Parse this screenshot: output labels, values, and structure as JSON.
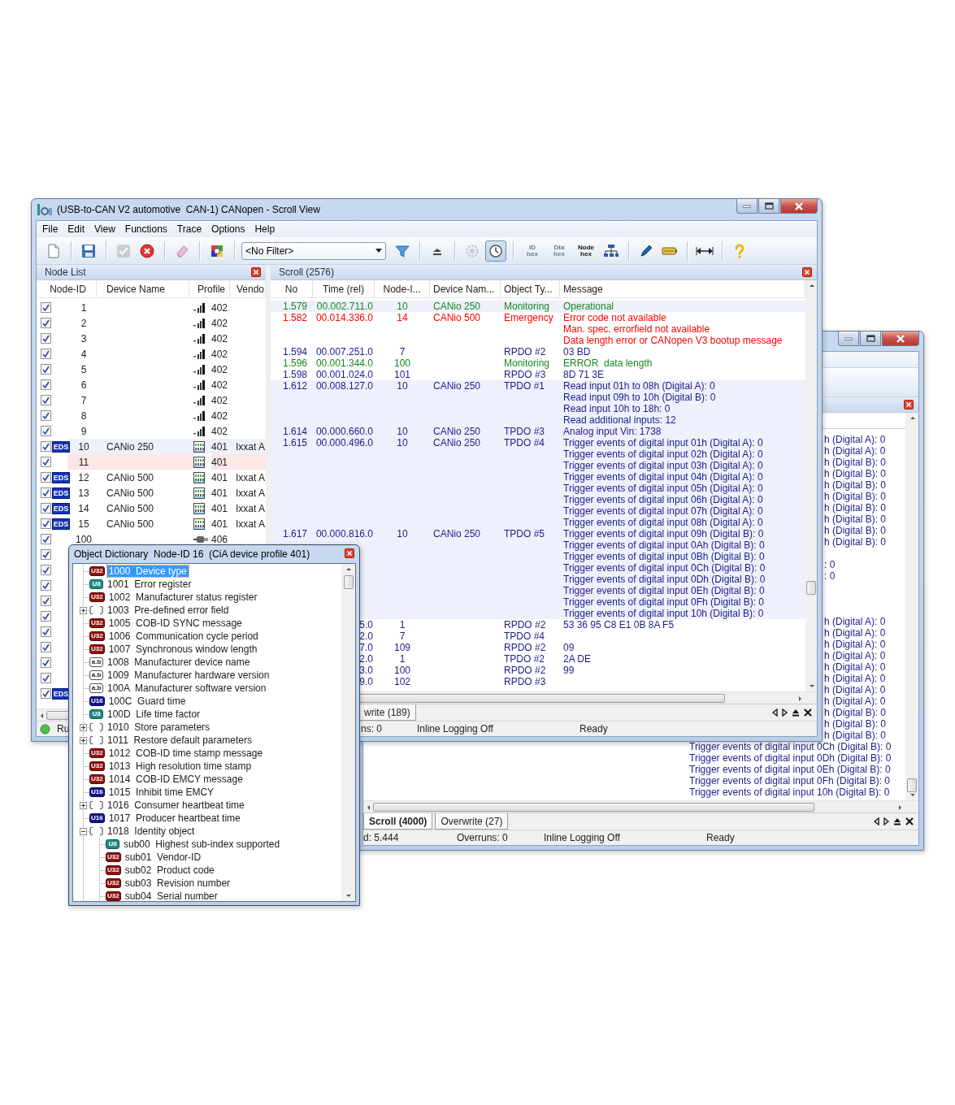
{
  "back_window": {
    "messages": [
      {
        "kind": "cut",
        "text": "h (Digital A): 0"
      },
      {
        "kind": "cut",
        "text": "h (Digital A): 0"
      },
      {
        "kind": "cut",
        "text": "h (Digital B): 0"
      },
      {
        "kind": "cut",
        "text": "h (Digital B): 0"
      },
      {
        "kind": "cut",
        "text": "h (Digital B): 0"
      },
      {
        "kind": "cut",
        "text": "h (Digital B): 0"
      },
      {
        "kind": "cut",
        "text": "h (Digital B): 0"
      },
      {
        "kind": "cut",
        "text": "h (Digital B): 0"
      },
      {
        "kind": "cut",
        "text": "h (Digital B): 0"
      },
      {
        "kind": "cut",
        "text": "h (Digital B): 0"
      },
      {
        "kind": "blank"
      },
      {
        "kind": "cut",
        "text": ": 0"
      },
      {
        "kind": "cut",
        "text": ": 0"
      },
      {
        "kind": "blank"
      },
      {
        "kind": "blank"
      },
      {
        "kind": "blank"
      },
      {
        "kind": "cut",
        "text": "h (Digital A): 0"
      },
      {
        "kind": "cut",
        "text": "h (Digital A): 0"
      },
      {
        "kind": "cut",
        "text": "h (Digital A): 0"
      },
      {
        "kind": "cut",
        "text": "h (Digital A): 0"
      },
      {
        "kind": "cut",
        "text": "h (Digital A): 0"
      },
      {
        "kind": "cut",
        "text": "h (Digital A): 0"
      },
      {
        "kind": "cut",
        "text": "h (Digital A): 0"
      },
      {
        "kind": "cut",
        "text": "h (Digital A): 0"
      },
      {
        "kind": "cut",
        "text": "h (Digital B): 0"
      },
      {
        "kind": "cut",
        "text": "h (Digital B): 0"
      },
      {
        "kind": "cut",
        "text": "h (Digital B): 0"
      },
      {
        "kind": "full",
        "text": "Trigger events of digital input 0Ch (Digital B): 0"
      },
      {
        "kind": "full",
        "text": "Trigger events of digital input 0Dh (Digital B): 0"
      },
      {
        "kind": "full",
        "text": "Trigger events of digital input 0Eh (Digital B): 0"
      },
      {
        "kind": "full",
        "text": "Trigger events of digital input 0Fh (Digital B): 0"
      },
      {
        "kind": "full",
        "text": "Trigger events of digital input 10h (Digital B): 0"
      }
    ],
    "tabs": [
      {
        "label": "Scroll (4000)",
        "selected": true
      },
      {
        "label": "Overwrite (27)",
        "selected": false
      }
    ],
    "status": [
      "d: 5.444",
      "Overruns: 0",
      "Inline Logging Off",
      "Ready"
    ]
  },
  "main_window": {
    "title": "(USB-to-CAN V2 automotive  CAN-1) CANopen - Scroll View",
    "menu": [
      {
        "label": "File"
      },
      {
        "label": "Edit"
      },
      {
        "label": "View"
      },
      {
        "label": "Functions"
      },
      {
        "label": "Trace"
      },
      {
        "label": "Options"
      },
      {
        "label": "Help"
      }
    ],
    "toolbar": [
      {
        "kind": "new",
        "disabled": false,
        "pressed": false
      },
      {
        "kind": "separator"
      },
      {
        "kind": "save",
        "disabled": false,
        "pressed": false
      },
      {
        "kind": "separator"
      },
      {
        "kind": "check",
        "disabled": true,
        "pressed": false
      },
      {
        "kind": "cancel",
        "disabled": false,
        "pressed": false
      },
      {
        "kind": "separator"
      },
      {
        "kind": "eraser",
        "disabled": false,
        "pressed": false
      },
      {
        "kind": "separator"
      },
      {
        "kind": "colors",
        "disabled": false,
        "pressed": false
      },
      {
        "kind": "separator"
      },
      {
        "kind": "select",
        "value": "<No Filter>"
      },
      {
        "kind": "funnel",
        "disabled": false,
        "pressed": false
      },
      {
        "kind": "separator"
      },
      {
        "kind": "eject",
        "disabled": false,
        "pressed": false
      },
      {
        "kind": "separator"
      },
      {
        "kind": "gear",
        "disabled": true,
        "pressed": false
      },
      {
        "kind": "clock",
        "disabled": false,
        "pressed": true
      },
      {
        "kind": "separator"
      },
      {
        "kind": "hex",
        "lines": [
          "ID",
          "hex"
        ],
        "disabled": true,
        "pressed": false
      },
      {
        "kind": "hex",
        "lines": [
          "Dta",
          "hex"
        ],
        "disabled": true,
        "pressed": false
      },
      {
        "kind": "hex",
        "lines": [
          "Node",
          "hex"
        ],
        "disabled": false,
        "pressed": false
      },
      {
        "kind": "tree",
        "disabled": false,
        "pressed": false
      },
      {
        "kind": "separator"
      },
      {
        "kind": "pen",
        "disabled": false,
        "pressed": false
      },
      {
        "kind": "battery",
        "disabled": false,
        "pressed": false
      },
      {
        "kind": "separator"
      },
      {
        "kind": "arrows",
        "disabled": false,
        "pressed": false
      },
      {
        "kind": "separator"
      },
      {
        "kind": "help",
        "disabled": false,
        "pressed": false
      }
    ],
    "node_list": {
      "title": "Node List",
      "columns": [
        "Node-ID",
        "Device Name",
        "Profile",
        "Vendo"
      ],
      "rows": [
        {
          "checked": true,
          "node_id": "1",
          "kind": "sensor",
          "profile": "402",
          "selected": false,
          "error": false
        },
        {
          "checked": true,
          "node_id": "2",
          "kind": "sensor",
          "profile": "402",
          "selected": false,
          "error": false
        },
        {
          "checked": true,
          "node_id": "3",
          "kind": "sensor",
          "profile": "402",
          "selected": false,
          "error": false
        },
        {
          "checked": true,
          "node_id": "4",
          "kind": "sensor",
          "profile": "402",
          "selected": false,
          "error": false
        },
        {
          "checked": true,
          "node_id": "5",
          "kind": "sensor",
          "profile": "402",
          "selected": false,
          "error": false
        },
        {
          "checked": true,
          "node_id": "6",
          "kind": "sensor",
          "profile": "402",
          "selected": false,
          "error": false
        },
        {
          "checked": true,
          "node_id": "7",
          "kind": "sensor",
          "profile": "402",
          "selected": false,
          "error": false
        },
        {
          "checked": true,
          "node_id": "8",
          "kind": "sensor",
          "profile": "402",
          "selected": false,
          "error": false
        },
        {
          "checked": true,
          "node_id": "9",
          "kind": "sensor",
          "profile": "402",
          "selected": false,
          "error": false
        },
        {
          "checked": true,
          "badge": "EDS",
          "node_id": "10",
          "device": "CANio 250",
          "kind": "io",
          "profile": "401",
          "vendor": "Ixxat A",
          "selected": true,
          "error": false
        },
        {
          "checked": true,
          "node_id": "11",
          "kind": "io",
          "profile": "401",
          "selected": false,
          "error": true
        },
        {
          "checked": true,
          "badge": "EDS",
          "node_id": "12",
          "device": "CANio 500",
          "kind": "io",
          "profile": "401",
          "vendor": "Ixxat A",
          "selected": false,
          "error": false
        },
        {
          "checked": true,
          "badge": "EDS",
          "node_id": "13",
          "device": "CANio 500",
          "kind": "io",
          "profile": "401",
          "vendor": "Ixxat A",
          "selected": false,
          "error": false
        },
        {
          "checked": true,
          "badge": "EDS",
          "node_id": "14",
          "device": "CANio 500",
          "kind": "io",
          "profile": "401",
          "vendor": "Ixxat A",
          "selected": false,
          "error": false
        },
        {
          "checked": true,
          "badge": "EDS",
          "node_id": "15",
          "device": "CANio 500",
          "kind": "io",
          "profile": "401",
          "vendor": "Ixxat A",
          "selected": false,
          "error": false
        },
        {
          "checked": true,
          "node_id": "100",
          "kind": "drive",
          "profile": "406",
          "selected": false,
          "error": false
        },
        {
          "checked": true,
          "selected": false,
          "error": false
        },
        {
          "checked": true,
          "selected": false,
          "error": false
        },
        {
          "checked": true,
          "selected": false,
          "error": false
        },
        {
          "checked": true,
          "selected": false,
          "error": false
        },
        {
          "checked": true,
          "selected": false,
          "error": false
        },
        {
          "checked": true,
          "selected": false,
          "error": false
        },
        {
          "checked": true,
          "selected": false,
          "error": false
        },
        {
          "checked": true,
          "selected": false,
          "error": false
        },
        {
          "checked": true,
          "selected": false,
          "error": false
        },
        {
          "checked": true,
          "badge": "EDS",
          "selected": false,
          "error": false
        }
      ]
    },
    "scroll": {
      "title": "Scroll (2576)",
      "columns": [
        "No",
        "Time (rel)",
        "Node-I...",
        "Device Nam...",
        "Object Ty...",
        "Message"
      ],
      "rows": [
        {
          "no": "1.579",
          "time": "00.002.711.0",
          "node": "10",
          "device": "CANio 250",
          "object": "Monitoring",
          "lines": [
            "Operational"
          ],
          "color": "#16881e",
          "selected": true
        },
        {
          "no": "1.582",
          "time": "00.014.336.0",
          "node": "14",
          "device": "CANio 500",
          "object": "Emergency",
          "lines": [
            "Error code not available",
            "Man. spec. errorfield not available",
            "Data length error or CANopen V3 bootup message"
          ],
          "color": "#ff0000",
          "selected": false
        },
        {
          "no": "1.594",
          "time": "00.007.251.0",
          "node": "7",
          "object": "RPDO #2",
          "lines": [
            "03 BD"
          ],
          "color": "#1c1c8a",
          "selected": false
        },
        {
          "no": "1.596",
          "time": "00.001.344.0",
          "node": "100",
          "object": "Monitoring",
          "lines": [
            "ERROR  data length"
          ],
          "color": "#16881e",
          "selected": false
        },
        {
          "no": "1.598",
          "time": "00.001.024.0",
          "node": "101",
          "object": "RPDO #3",
          "lines": [
            "8D 71 3E"
          ],
          "color": "#1c1c8a",
          "selected": false
        },
        {
          "no": "1.612",
          "time": "00.008.127.0",
          "node": "10",
          "device": "CANio 250",
          "object": "TPDO #1",
          "lines": [
            "Read input 01h to 08h (Digital A): 0",
            "Read input 09h to 10h (Digital B): 0",
            "Read input 10h to 18h: 0",
            "Read additional inputs: 12"
          ],
          "color": "#1c1c8a",
          "selected": true
        },
        {
          "no": "1.614",
          "time": "00.000.660.0",
          "node": "10",
          "device": "CANio 250",
          "object": "TPDO #3",
          "lines": [
            "Analog input Vin: 1738"
          ],
          "color": "#1c1c8a",
          "selected": true
        },
        {
          "no": "1.615",
          "time": "00.000.496.0",
          "node": "10",
          "device": "CANio 250",
          "object": "TPDO #4",
          "lines": [
            "Trigger events of digital input 01h (Digital A): 0",
            "Trigger events of digital input 02h (Digital A): 0",
            "Trigger events of digital input 03h (Digital A): 0",
            "Trigger events of digital input 04h (Digital A): 0",
            "Trigger events of digital input 05h (Digital A): 0",
            "Trigger events of digital input 06h (Digital A): 0",
            "Trigger events of digital input 07h (Digital A): 0",
            "Trigger events of digital input 08h (Digital A): 0"
          ],
          "color": "#1c1c8a",
          "selected": true
        },
        {
          "no": "1.617",
          "time": "00.000.816.0",
          "node": "10",
          "device": "CANio 250",
          "object": "TPDO #5",
          "lines": [
            "Trigger events of digital input 09h (Digital B): 0",
            "Trigger events of digital input 0Ah (Digital B): 0",
            "Trigger events of digital input 0Bh (Digital B): 0",
            "Trigger events of digital input 0Ch (Digital B): 0",
            "Trigger events of digital input 0Dh (Digital B): 0",
            "Trigger events of digital input 0Eh (Digital B): 0",
            "Trigger events of digital input 0Fh (Digital B): 0",
            "Trigger events of digital input 10h (Digital B): 0"
          ],
          "color": "#1c1c8a",
          "selected": true
        },
        {
          "time": "5.0",
          "node": "1",
          "object": "RPDO #2",
          "lines": [
            "53 36 95 C8 E1 0B 8A F5"
          ],
          "color": "#1c1c8a",
          "selected": false
        },
        {
          "time": "2.0",
          "node": "7",
          "object": "TPDO #4",
          "color": "#1c1c8a",
          "selected": false
        },
        {
          "time": "7.0",
          "node": "109",
          "object": "RPDO #2",
          "lines": [
            "09"
          ],
          "color": "#1c1c8a",
          "selected": false
        },
        {
          "time": "2.0",
          "node": "1",
          "object": "TPDO #2",
          "lines": [
            "2A DE"
          ],
          "color": "#1c1c8a",
          "selected": false
        },
        {
          "time": "3.0",
          "node": "100",
          "object": "RPDO #2",
          "lines": [
            "99"
          ],
          "color": "#1c1c8a",
          "selected": false
        },
        {
          "time": "9.0",
          "node": "102",
          "object": "RPDO #3",
          "color": "#1c1c8a",
          "selected": false
        }
      ],
      "tabs": [
        {
          "label": "write (189)",
          "selected": false
        }
      ]
    },
    "status_label": "Ru",
    "status": [
      "ns: 0",
      "Inline Logging Off",
      "Ready"
    ]
  },
  "object_dictionary": {
    "title": "Object Dictionary  Node-ID 16  (CiA device profile 401)",
    "items": [
      {
        "kind": "u32",
        "type": "U32",
        "label": "1000  Device type",
        "selected": true
      },
      {
        "kind": "u8",
        "type": "U8",
        "label": "1001  Error register",
        "selected": false
      },
      {
        "kind": "u32",
        "type": "U32",
        "label": "1002  Manufacturer status register",
        "selected": false
      },
      {
        "kind": "record",
        "label": "1003  Pre-defined error field",
        "expanded": false,
        "selected": false
      },
      {
        "kind": "u32",
        "type": "U32",
        "label": "1005  COB-ID SYNC message",
        "selected": false
      },
      {
        "kind": "u32",
        "type": "U32",
        "label": "1006  Communication cycle period",
        "selected": false
      },
      {
        "kind": "u32",
        "type": "U32",
        "label": "1007  Synchronous window length",
        "selected": false
      },
      {
        "kind": "string",
        "type": "a.b",
        "label": "1008  Manufacturer device name",
        "selected": false
      },
      {
        "kind": "string",
        "type": "a.b",
        "label": "1009  Manufacturer hardware version",
        "selected": false
      },
      {
        "kind": "string",
        "type": "a.b",
        "label": "100A  Manufacturer software version",
        "selected": false
      },
      {
        "kind": "u16",
        "type": "U16",
        "label": "100C  Guard time",
        "selected": false
      },
      {
        "kind": "u8",
        "type": "U8",
        "label": "100D  Life time factor",
        "selected": false
      },
      {
        "kind": "record",
        "label": "1010  Store parameters",
        "expanded": false,
        "selected": false
      },
      {
        "kind": "record",
        "label": "1011  Restore default parameters",
        "expanded": false,
        "selected": false
      },
      {
        "kind": "u32",
        "type": "U32",
        "label": "1012  COB-ID time stamp message",
        "selected": false
      },
      {
        "kind": "u32",
        "type": "U32",
        "label": "1013  High resolution time stamp",
        "selected": false
      },
      {
        "kind": "u32",
        "type": "U32",
        "label": "1014  COB-ID EMCY message",
        "selected": false
      },
      {
        "kind": "u16",
        "type": "U16",
        "label": "1015  Inhibit time EMCY",
        "selected": false
      },
      {
        "kind": "record",
        "label": "1016  Consumer heartbeat time",
        "expanded": false,
        "selected": false
      },
      {
        "kind": "u16",
        "type": "U16",
        "label": "1017  Producer heartbeat time",
        "selected": false
      },
      {
        "kind": "record",
        "label": "1018  Identity object",
        "expanded": true,
        "selected": false,
        "children": [
          {
            "kind": "u8",
            "type": "U8",
            "label": "sub00  Highest sub-index supported",
            "selected": false
          },
          {
            "kind": "u32",
            "type": "U32",
            "label": "sub01  Vendor-ID",
            "selected": false
          },
          {
            "kind": "u32",
            "type": "U32",
            "label": "sub02  Product code",
            "selected": false
          },
          {
            "kind": "u32",
            "type": "U32",
            "label": "sub03  Revision number",
            "selected": false
          },
          {
            "kind": "u32",
            "type": "U32",
            "label": "sub04  Serial number",
            "selected": false
          }
        ]
      }
    ]
  }
}
